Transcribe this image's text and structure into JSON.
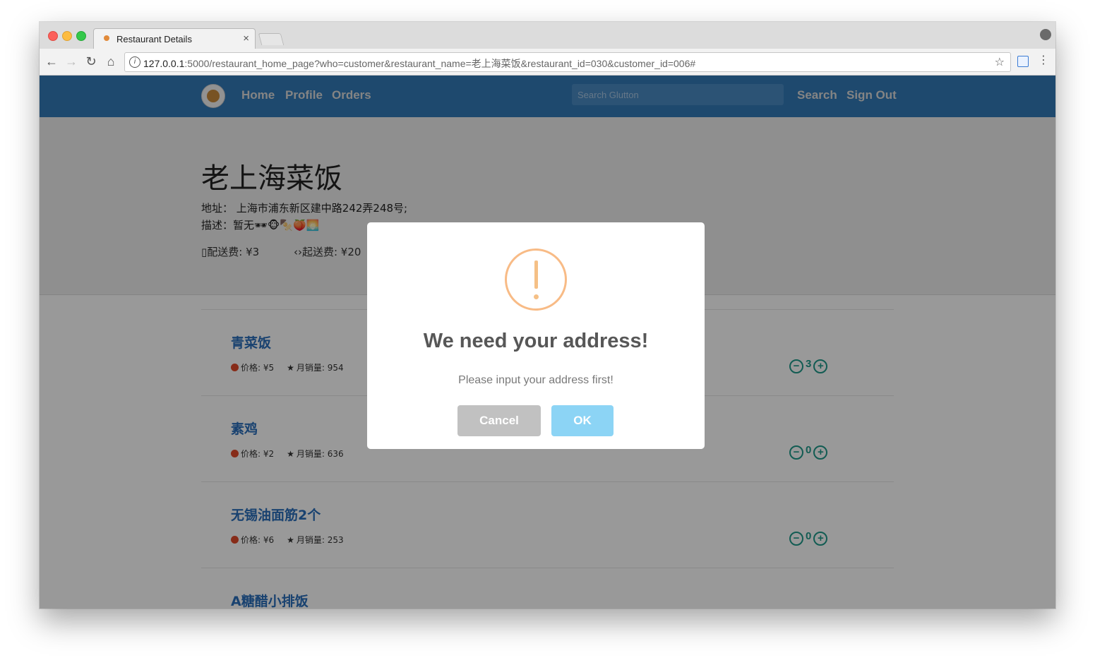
{
  "browser": {
    "tab_title": "Restaurant Details",
    "tab_close": "×",
    "url_host": "127.0.0.1",
    "url_rest": ":5000/restaurant_home_page?who=customer&restaurant_name=老上海菜饭&restaurant_id=030&customer_id=006#",
    "info_glyph": "i",
    "back": "←",
    "forward": "→",
    "reload": "↻",
    "home": "⌂",
    "star": "☆",
    "menu": "⋮"
  },
  "navbar": {
    "links": [
      "Home",
      "Profile",
      "Orders"
    ],
    "search_placeholder": "Search Glutton",
    "search_button": "Search",
    "signout": "Sign Out",
    "color": "#337ab7"
  },
  "restaurant": {
    "name": "老上海菜饭",
    "address_label": "地址：",
    "address": "上海市浦东新区建中路242弄248号;",
    "desc_label": "描述：",
    "desc": "暂无🕶🐵🍢🍑🌅",
    "delivery_fee": "配送费: ¥3",
    "min_order": "起送费: ¥20"
  },
  "dishes": [
    {
      "name": "青菜饭",
      "price": "价格: ¥5",
      "sales": "月销量: 954",
      "qty": "3"
    },
    {
      "name": "素鸡",
      "price": "价格: ¥2",
      "sales": "月销量: 636",
      "qty": "0"
    },
    {
      "name": "无锡油面筋2个",
      "price": "价格: ¥6",
      "sales": "月销量: 253",
      "qty": "0"
    },
    {
      "name": "A糖醋小排饭",
      "price": "",
      "sales": "",
      "qty": ""
    }
  ],
  "modal": {
    "title": "We need your address!",
    "text": "Please input your address first!",
    "cancel": "Cancel",
    "ok": "OK",
    "warning_color": "#f8bb86"
  }
}
